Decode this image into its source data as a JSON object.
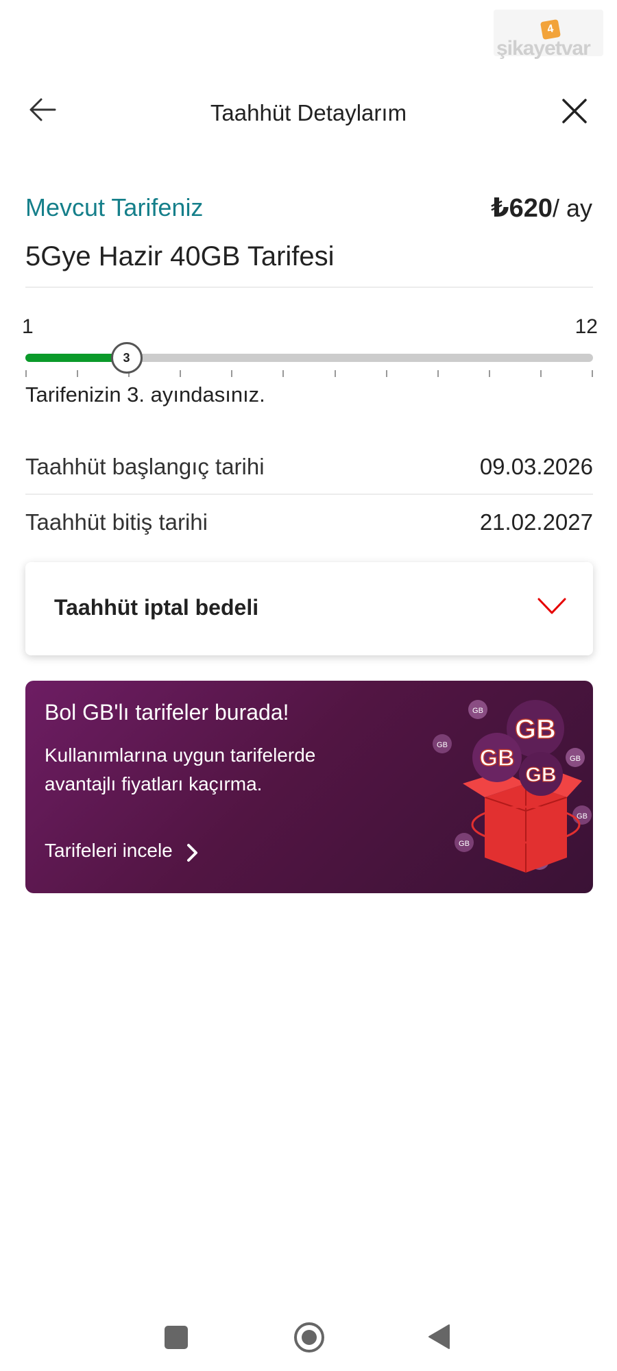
{
  "watermark": {
    "brand_text": "şikayetvar",
    "badge": "4"
  },
  "header": {
    "title": "Taahhüt Detaylarım",
    "back_icon": "arrow-left-icon",
    "close_icon": "close-icon"
  },
  "tariff": {
    "current_label": "Mevcut Tarifeniz",
    "price_amount": "₺620",
    "price_unit": "/ ay",
    "name": "5Gye Hazir 40GB Tarifesi"
  },
  "commitment_progress": {
    "min_label": "1",
    "max_label": "12",
    "current_month": 3,
    "current_month_label": "3",
    "total_months": 12,
    "status_text": "Tarifenizin 3. ayındasınız."
  },
  "dates": {
    "start_label": "Taahhüt başlangıç tarihi",
    "start_value": "09.03.2026",
    "end_label": "Taahhüt bitiş tarihi",
    "end_value": "21.02.2027"
  },
  "cancel_fee": {
    "title": "Taahhüt iptal bedeli",
    "chevron_icon": "chevron-down-icon",
    "accent": "#e60000"
  },
  "promo": {
    "title": "Bol GB'lı tarifeler burada!",
    "description": "Kullanımlarına uygun tarifelerde avantajlı fiyatları kaçırma.",
    "link_label": "Tarifeleri incele",
    "art_badges": [
      "GB",
      "GB",
      "GB"
    ],
    "art_small_badges": [
      "GB",
      "GB",
      "GB",
      "GB",
      "GB",
      "GB"
    ]
  },
  "navbar": {
    "recents_icon": "square-icon",
    "home_icon": "home-circle-icon",
    "back_icon": "back-triangle-icon"
  },
  "colors": {
    "teal": "#157f8a",
    "progress_green": "#0a9a2a",
    "promo_purple": "#5a1850",
    "red": "#e60000"
  }
}
